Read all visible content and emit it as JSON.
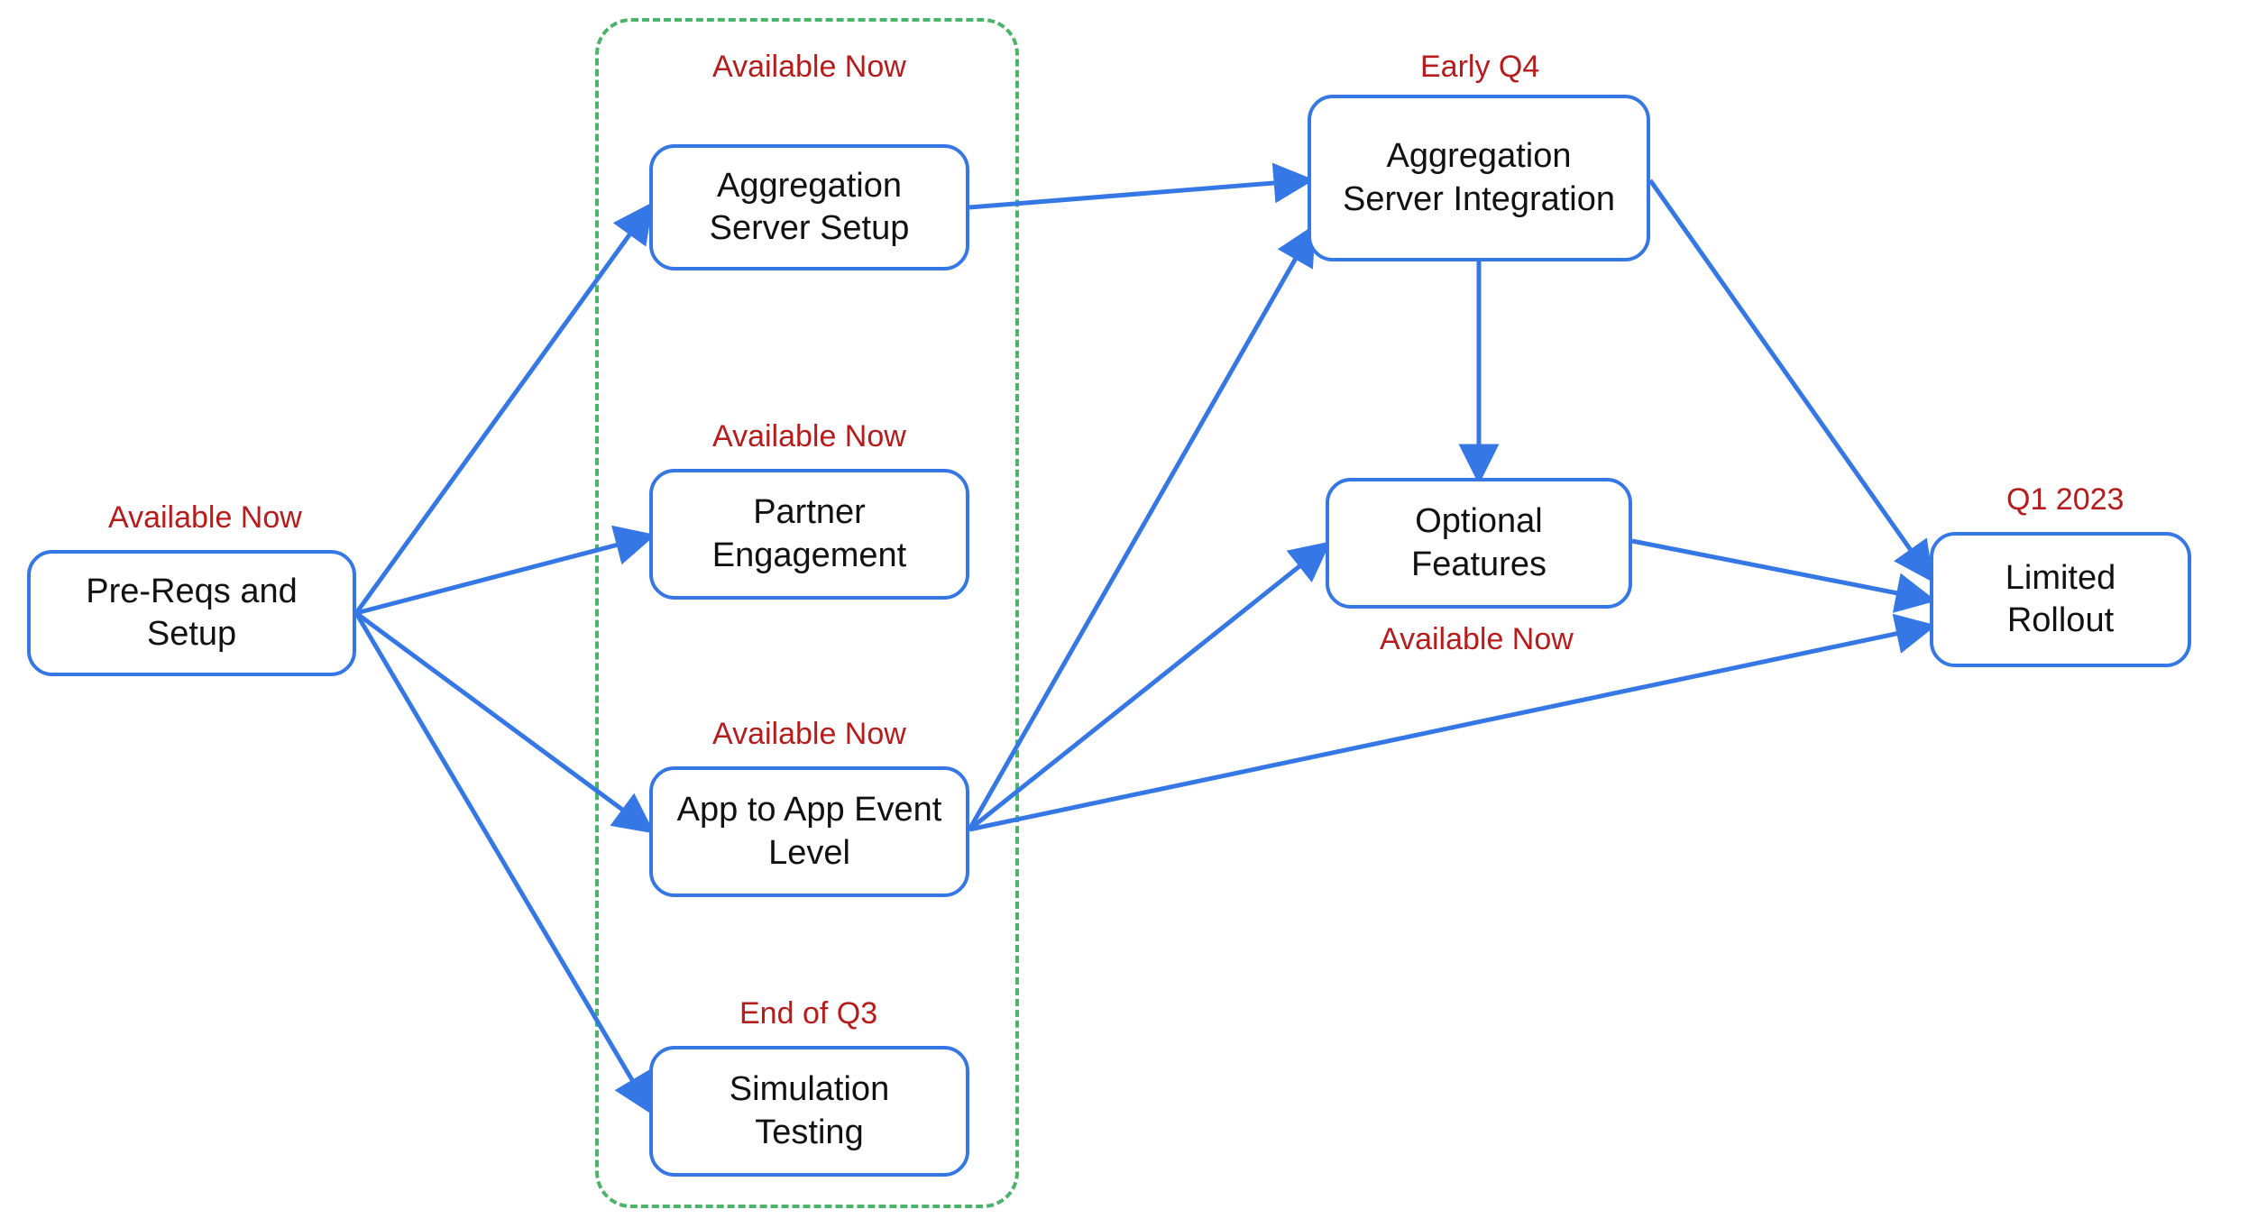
{
  "chart_data": {
    "type": "diagram",
    "title": "",
    "nodes": [
      {
        "id": "prereqs",
        "label": "Pre-Reqs and Setup",
        "tag": "Available Now"
      },
      {
        "id": "aggsetup",
        "label": "Aggregation Server Setup",
        "tag": "Available Now"
      },
      {
        "id": "partner",
        "label": "Partner Engagement",
        "tag": "Available Now"
      },
      {
        "id": "appapp",
        "label": "App to App Event Level",
        "tag": "Available Now"
      },
      {
        "id": "sim",
        "label": "Simulation Testing",
        "tag": "End of Q3"
      },
      {
        "id": "aggint",
        "label": "Aggregation Server Integration",
        "tag": "Early Q4"
      },
      {
        "id": "optional",
        "label": "Optional Features",
        "tag": "Available Now"
      },
      {
        "id": "rollout",
        "label": "Limited Rollout",
        "tag": "Q1 2023"
      }
    ],
    "groups": [
      {
        "id": "now-group",
        "members": [
          "aggsetup",
          "partner",
          "appapp",
          "sim"
        ]
      }
    ],
    "edges": [
      [
        "prereqs",
        "aggsetup"
      ],
      [
        "prereqs",
        "partner"
      ],
      [
        "prereqs",
        "appapp"
      ],
      [
        "prereqs",
        "sim"
      ],
      [
        "aggsetup",
        "aggint"
      ],
      [
        "appapp",
        "aggint"
      ],
      [
        "appapp",
        "optional"
      ],
      [
        "appapp",
        "rollout"
      ],
      [
        "aggint",
        "optional"
      ],
      [
        "aggint",
        "rollout"
      ],
      [
        "optional",
        "rollout"
      ]
    ]
  },
  "colors": {
    "node_border": "#3578e5",
    "edge": "#3578e5",
    "group_border": "#4bb36a",
    "tag_text": "#b71c1c"
  }
}
